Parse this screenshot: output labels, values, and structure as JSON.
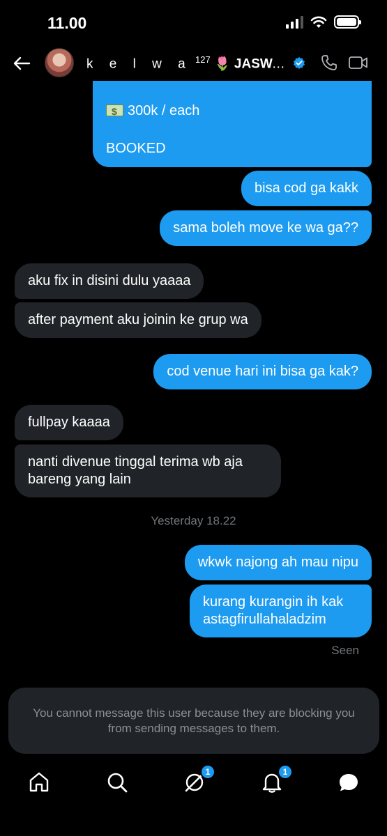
{
  "status_bar": {
    "time": "11.00"
  },
  "header": {
    "name_prefix": "k e l w a",
    "name_sup": "127",
    "name_emoji": "🌷",
    "name_main": "JASWAR JA...",
    "verified_icon": "verified-badge-icon",
    "icons": [
      "back-arrow-icon",
      "phone-icon",
      "video-icon"
    ]
  },
  "messages": [
    {
      "from": "me",
      "text_line1": "300k / each",
      "text_line2": "BOOKED",
      "emoji": "money-bill-icon"
    },
    {
      "from": "me",
      "text": "bisa cod ga kakk"
    },
    {
      "from": "me",
      "text": "sama boleh move ke wa ga??"
    },
    {
      "from": "them",
      "text": "aku fix in disini dulu yaaaa"
    },
    {
      "from": "them",
      "text": "after payment aku joinin ke grup wa"
    },
    {
      "from": "me",
      "text": "cod venue hari ini bisa ga kak?"
    },
    {
      "from": "them",
      "text": "fullpay kaaaa"
    },
    {
      "from": "them",
      "text": "nanti divenue tinggal terima wb aja bareng yang lain"
    },
    {
      "from": "me",
      "text": "wkwk najong ah mau nipu"
    },
    {
      "from": "me",
      "text": "kurang kurangin ih kak astagfirullahaladzim"
    }
  ],
  "timestamp": "Yesterday 18.22",
  "seen_label": "Seen",
  "blocked_notice": "You cannot message this user because they are blocking you from sending messages to them.",
  "nav": {
    "items": [
      "home-icon",
      "search-icon",
      "grok-icon",
      "notifications-icon",
      "messages-icon"
    ],
    "grok_badge": "1",
    "notifications_badge": "1"
  },
  "colors": {
    "background": "#000000",
    "outgoing_bubble": "#1d9bf0",
    "incoming_bubble": "#202327",
    "muted_text": "#71767b"
  }
}
